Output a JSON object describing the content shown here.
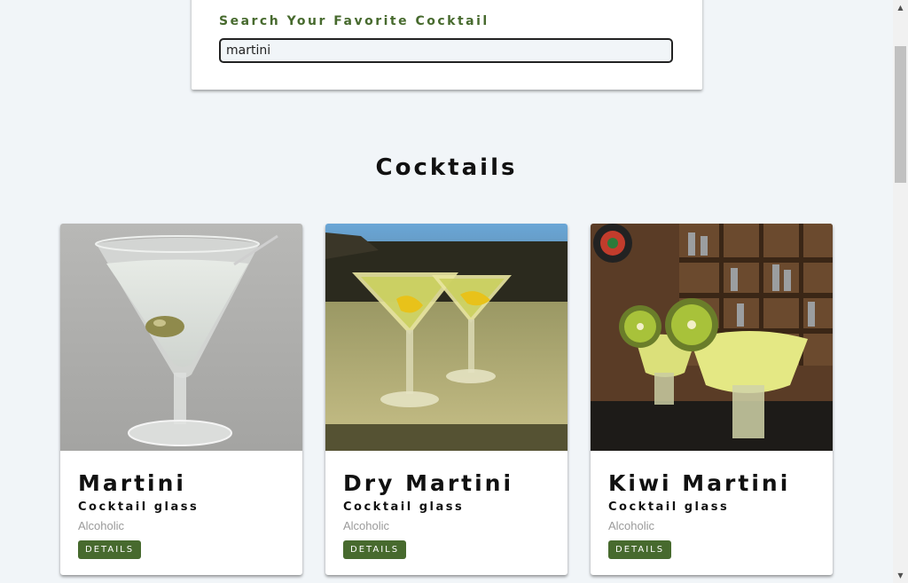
{
  "search": {
    "label": "Search Your Favorite Cocktail",
    "value": "martini"
  },
  "section_title": "Cocktails",
  "cocktails": [
    {
      "name": "Martini",
      "glass": "Cocktail glass",
      "type": "Alcoholic",
      "button": "DETAILS"
    },
    {
      "name": "Dry Martini",
      "glass": "Cocktail glass",
      "type": "Alcoholic",
      "button": "DETAILS"
    },
    {
      "name": "Kiwi Martini",
      "glass": "Cocktail glass",
      "type": "Alcoholic",
      "button": "DETAILS"
    }
  ],
  "colors": {
    "accent": "#476a2e",
    "background": "#f1f5f8"
  },
  "scrollbar": {
    "up_icon": "scroll-up-arrow-icon",
    "down_icon": "scroll-down-arrow-icon"
  }
}
